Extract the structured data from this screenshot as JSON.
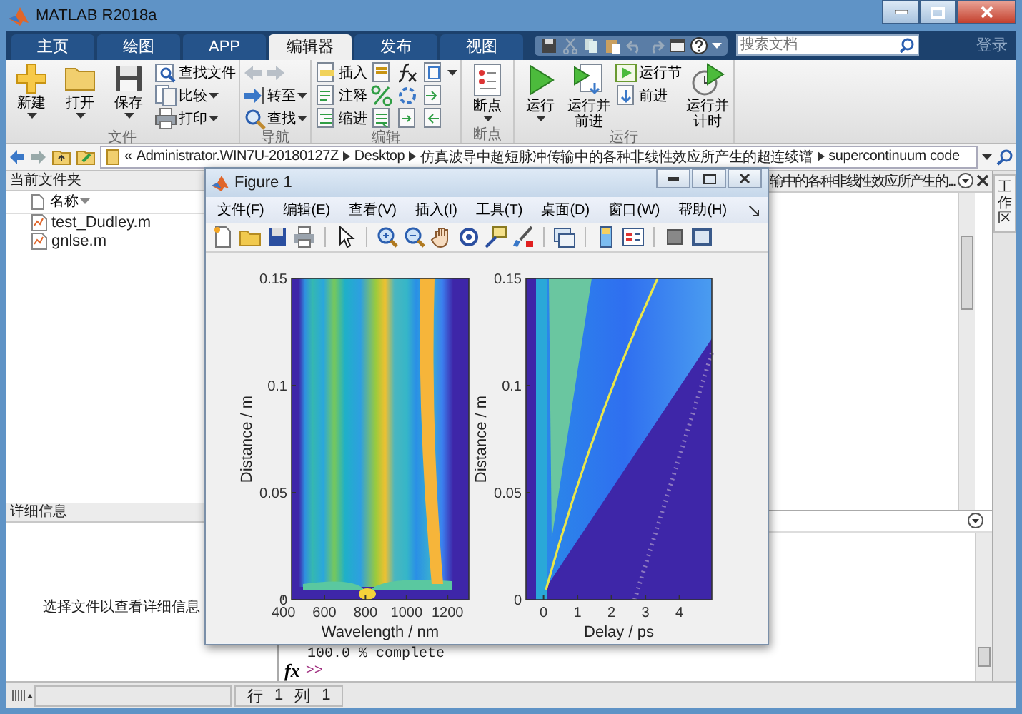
{
  "window": {
    "title": "MATLAB R2018a"
  },
  "tabs": [
    {
      "label": "主页",
      "selected": false
    },
    {
      "label": "绘图",
      "selected": false
    },
    {
      "label": "APP",
      "selected": false
    },
    {
      "label": "编辑器",
      "selected": true
    },
    {
      "label": "发布",
      "selected": false
    },
    {
      "label": "视图",
      "selected": false
    }
  ],
  "search": {
    "placeholder": "搜索文档"
  },
  "login": "登录",
  "ribbon": [
    {
      "title": "文件",
      "columns": [
        {
          "kind": "large",
          "items": [
            {
              "label": "新建",
              "dropdown": true
            }
          ]
        },
        {
          "kind": "large",
          "items": [
            {
              "label": "打开",
              "dropdown": true
            }
          ]
        },
        {
          "kind": "large",
          "items": [
            {
              "label": "保存",
              "dropdown": true
            }
          ]
        },
        {
          "kind": "stack",
          "items": [
            {
              "label": "查找文件",
              "dropdown": false
            },
            {
              "label": "比较",
              "dropdown": true
            },
            {
              "label": "打印",
              "dropdown": true
            }
          ]
        }
      ]
    },
    {
      "title": "导航",
      "columns": [
        {
          "kind": "stack",
          "items": [
            {
              "dropdown": false,
              "disabled": true
            },
            {
              "label": "转至",
              "dropdown": true,
              "disabled": false
            },
            {
              "label": "查找",
              "dropdown": true,
              "disabled": false
            }
          ]
        }
      ]
    },
    {
      "title": "编辑",
      "columns": [
        {
          "kind": "stack",
          "items": [
            {
              "label": "插入",
              "dropdown": false
            },
            {
              "label": "注释",
              "dropdown": false
            },
            {
              "label": "缩进",
              "dropdown": false
            }
          ]
        },
        {
          "kind": "stack",
          "items": [
            {
              "dropdown": false
            },
            {
              "dropdown": false
            },
            {
              "dropdown": false
            }
          ]
        },
        {
          "kind": "stack",
          "items": [
            {
              "dropdown": false
            },
            {
              "dropdown": false
            },
            {
              "dropdown": false
            }
          ]
        },
        {
          "kind": "stack",
          "items": [
            {
              "dropdown": true
            },
            {
              "dropdown": false
            },
            {
              "dropdown": false
            }
          ]
        }
      ]
    },
    {
      "title": "断点",
      "columns": [
        {
          "kind": "large",
          "items": [
            {
              "label": "断点",
              "dropdown": true
            }
          ]
        }
      ]
    },
    {
      "title": "运行",
      "columns": [
        {
          "kind": "large",
          "items": [
            {
              "label": "运行",
              "dropdown": true
            }
          ]
        },
        {
          "kind": "large",
          "items": [
            {
              "label": "运行并前进",
              "dropdown": false
            }
          ]
        },
        {
          "kind": "stack",
          "items": [
            {
              "label": "运行节",
              "dropdown": false
            },
            {
              "label": "前进",
              "dropdown": false
            }
          ]
        },
        {
          "kind": "large",
          "items": [
            {
              "label": "运行并计时",
              "dropdown": false
            }
          ]
        }
      ]
    }
  ],
  "address": {
    "prefix": "«",
    "segments": [
      "Administrator.WIN7U-20180127Z",
      "Desktop",
      "仿真波导中超短脉冲传输中的各种非线性效应所产生的超连续谱",
      "supercontinuum code"
    ]
  },
  "current_folder": {
    "title": "当前文件夹",
    "column": "名称",
    "files": [
      "test_Dudley.m",
      "gnlse.m"
    ]
  },
  "details": {
    "title": "详细信息",
    "message": "选择文件以查看详细信息"
  },
  "editor": {
    "tab_title": "输中的各种非线性效应所产生的..."
  },
  "side_tab": "工作区",
  "command_window": {
    "lines": [
      "100.0 % complete"
    ],
    "function_button": "fx",
    "prompt": ">>"
  },
  "status_bar": {
    "row_label": "行",
    "row": "1",
    "col_label": "列",
    "col": "1"
  },
  "figure": {
    "title": "Figure 1",
    "menus": [
      "文件(F)",
      "编辑(E)",
      "查看(V)",
      "插入(I)",
      "工具(T)",
      "桌面(D)",
      "窗口(W)",
      "帮助(H)"
    ],
    "plots": [
      {
        "ylabel": "Distance / m",
        "xlabel": "Wavelength / nm",
        "yticks": [
          "0.15",
          "0.1",
          "0.05",
          "0"
        ],
        "xticks": [
          "400",
          "600",
          "800",
          "1000",
          "1200"
        ]
      },
      {
        "ylabel": "Distance / m",
        "xlabel": "Delay / ps",
        "yticks": [
          "0.15",
          "0.1",
          "0.05",
          "0"
        ],
        "xticks": [
          "0",
          "1",
          "2",
          "3",
          "4"
        ]
      }
    ]
  }
}
